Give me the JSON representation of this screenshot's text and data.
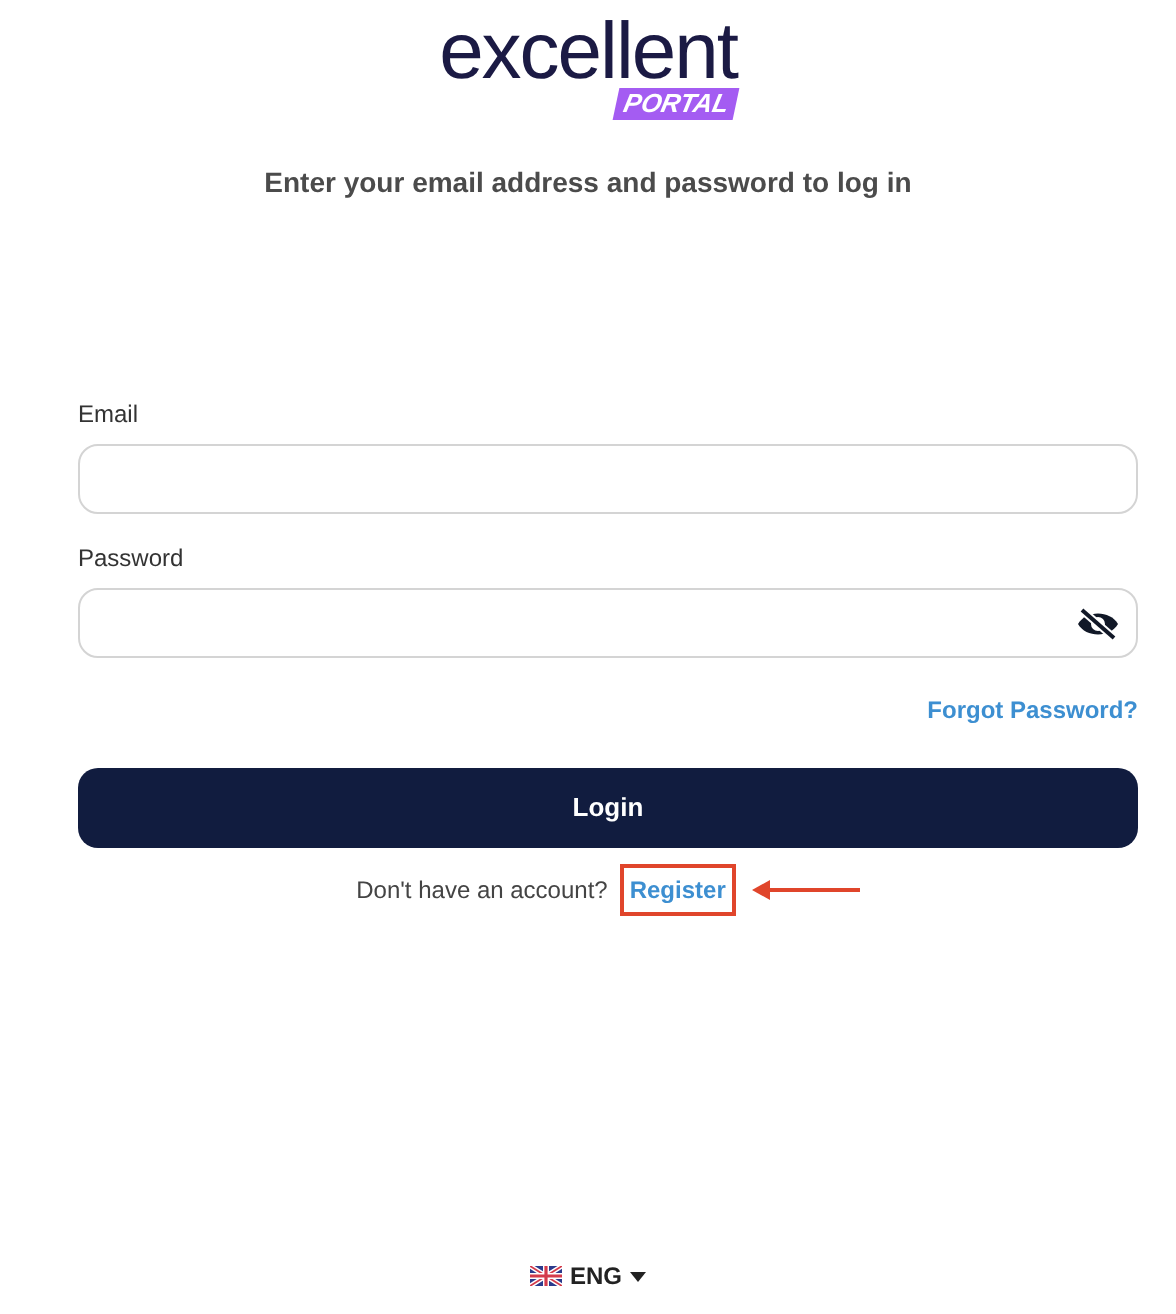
{
  "logo": {
    "wordmark": "excellent",
    "badge": "PORTAL"
  },
  "subtitle": "Enter your email address and password to log in",
  "fields": [
    {
      "label": "Email",
      "kind": "text"
    },
    {
      "label": "Password",
      "kind": "password"
    }
  ],
  "forgot_link": "Forgot Password?",
  "login_button": "Login",
  "register": {
    "prompt": "Don't have an account?",
    "link": "Register",
    "highlighted": true
  },
  "language": {
    "code": "ENG"
  }
}
